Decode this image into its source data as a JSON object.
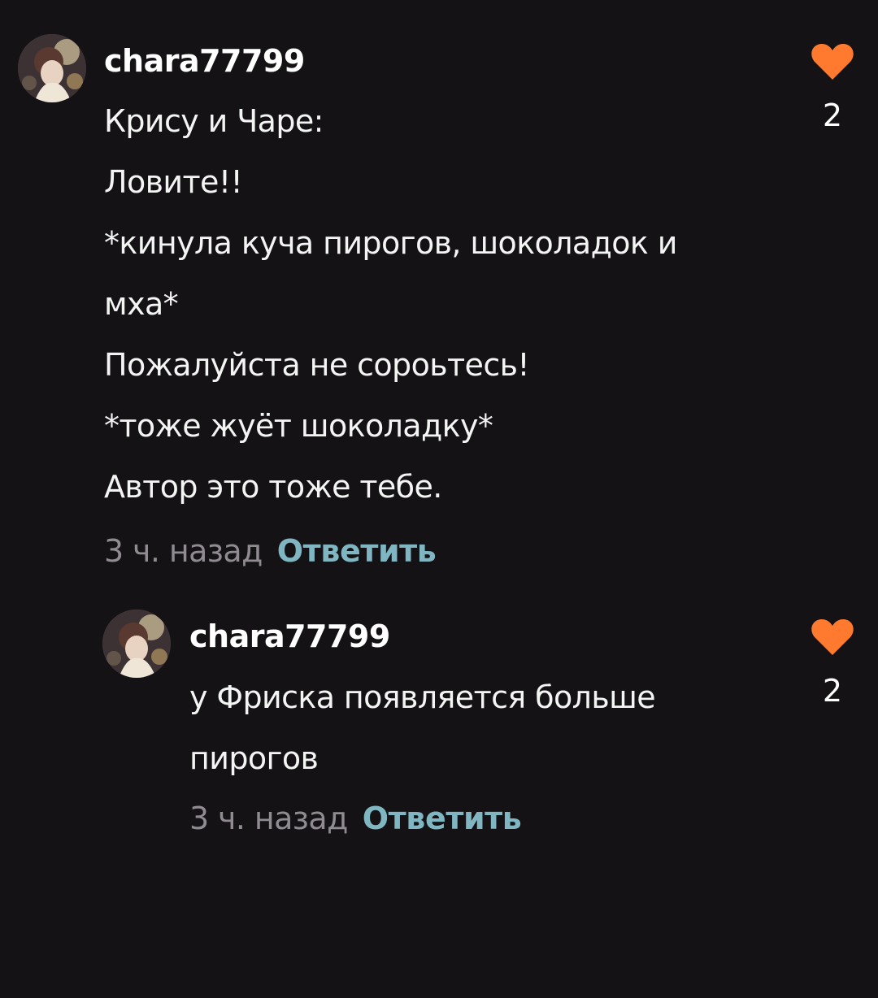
{
  "comments": [
    {
      "username": "chara77799",
      "lines": [
        "Крису и Чаре:",
        "Ловите!!",
        "*кинула куча пирогов, шоколадок и",
        "мха*",
        "Пожалуйста не сороьтесь!",
        "*тоже жуёт шоколадку*",
        "Автор это тоже тебе."
      ],
      "time": "3 ч. назад",
      "reply_label": "Ответить",
      "likes": "2",
      "avatar_icon": "avatar-image",
      "heart_icon": "heart-icon"
    },
    {
      "username": "chara77799",
      "lines": [
        "у Фриска появляется больше",
        "пирогов"
      ],
      "time": "3 ч. назад",
      "reply_label": "Ответить",
      "likes": "2",
      "avatar_icon": "avatar-image",
      "heart_icon": "heart-icon"
    }
  ],
  "colors": {
    "background": "#141215",
    "heart": "#ff7a2f",
    "reply": "#7fb6c2",
    "time": "#8f8b91"
  }
}
